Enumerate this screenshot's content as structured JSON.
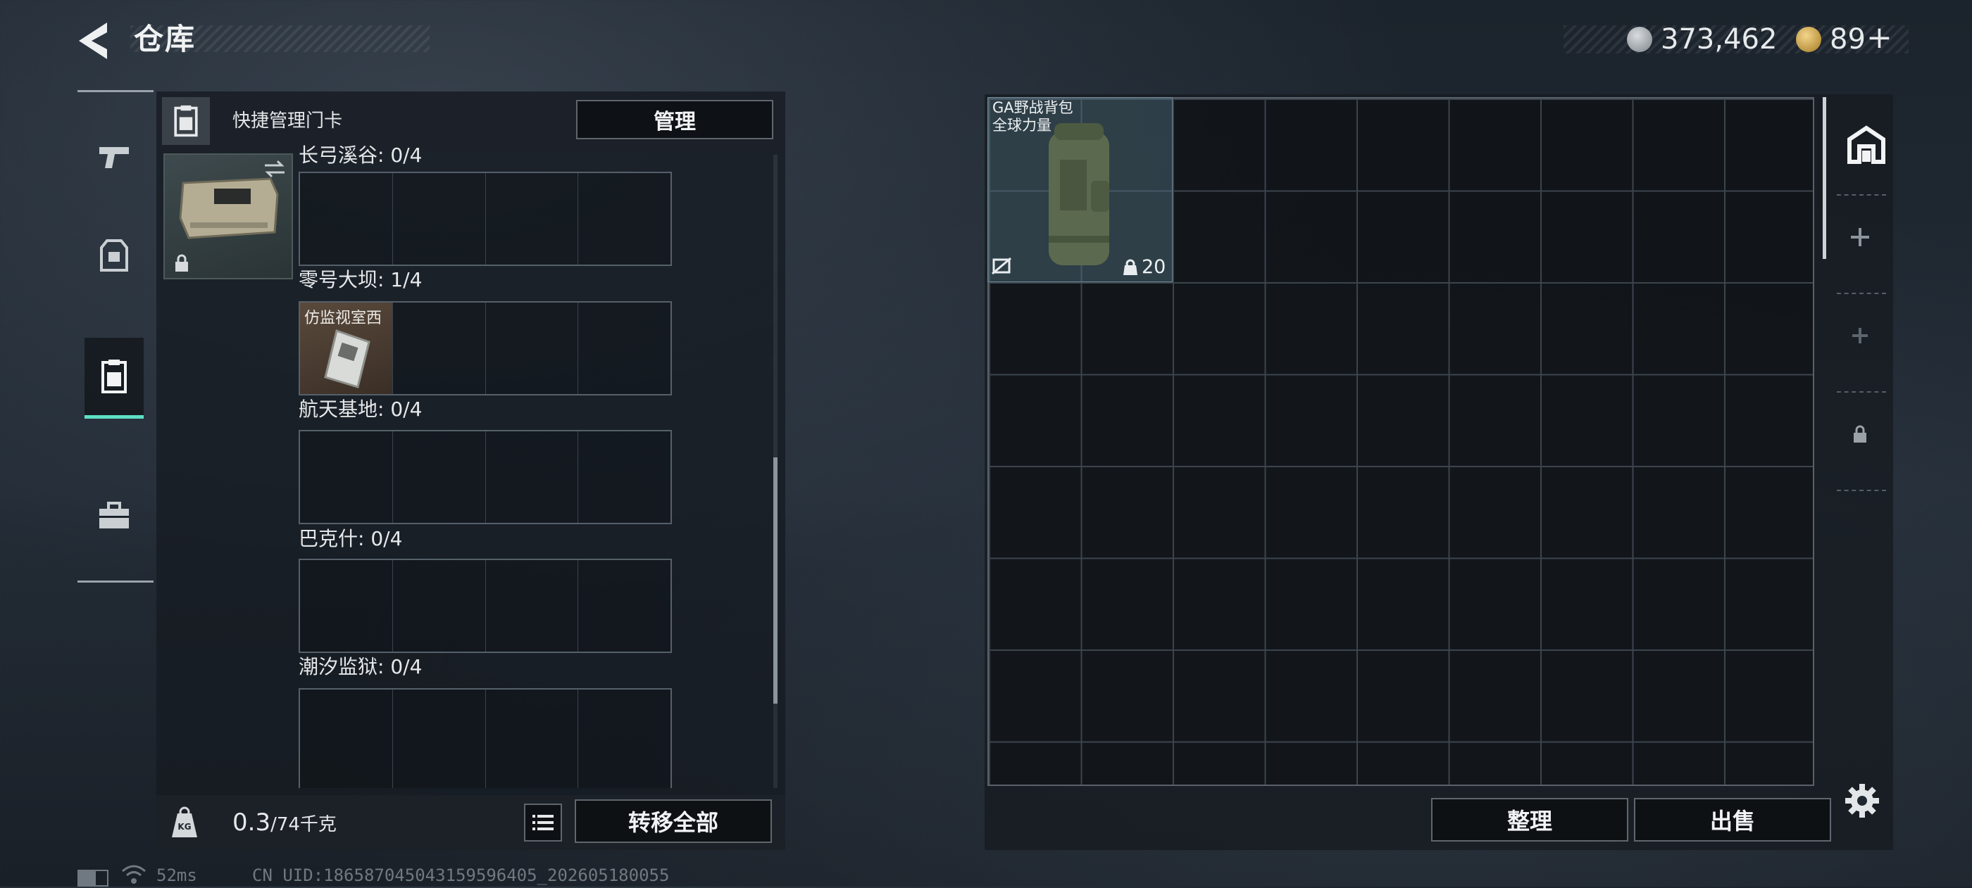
{
  "header": {
    "title": "仓库",
    "silver_amount": "373,462",
    "gold_amount": "89",
    "gold_plus": "+"
  },
  "left_panel": {
    "quick_card_label": "快捷管理门卡",
    "manage_button": "管理",
    "categories": [
      {
        "name": "长弓溪谷",
        "count": "0/4",
        "items": []
      },
      {
        "name": "零号大坝",
        "count": "1/4",
        "items": [
          {
            "name": "仿监视室西"
          }
        ]
      },
      {
        "name": "航天基地",
        "count": "0/4",
        "items": []
      },
      {
        "name": "巴克什",
        "count": "0/4",
        "items": []
      },
      {
        "name": "潮汐监狱",
        "count": "0/4",
        "items": []
      }
    ],
    "weight": {
      "current": "0.3",
      "max": "/74千克",
      "unit_icon_text": "KG"
    },
    "transfer_all_button": "转移全部"
  },
  "right_panel": {
    "backpack": {
      "name": "GA野战背包",
      "subtitle": "全球力量",
      "capacity": "20"
    },
    "sort_button": "整理",
    "sell_button": "出售"
  },
  "status_bar": {
    "ping": "52ms",
    "uid": "CN UID:18658704504315959640​5_202605180055",
    "battery_level": 0.6
  },
  "icons": {
    "back": "back-arrow-icon",
    "silver_coin": "silver-coin-icon",
    "gold_coin": "gold-coin-icon",
    "weapon": "pistol-icon",
    "gear": "armor-icon",
    "keycard": "keycard-icon",
    "case": "briefcase-icon",
    "swap": "swap-icon",
    "lock": "lock-icon",
    "list": "list-icon",
    "warehouse": "warehouse-icon",
    "add": "add-icon",
    "settings": "gear-icon"
  },
  "colors": {
    "accent": "#5ee0c4",
    "background": "#1f2730",
    "panel": "#161b21",
    "text": "#e3e6e8"
  }
}
